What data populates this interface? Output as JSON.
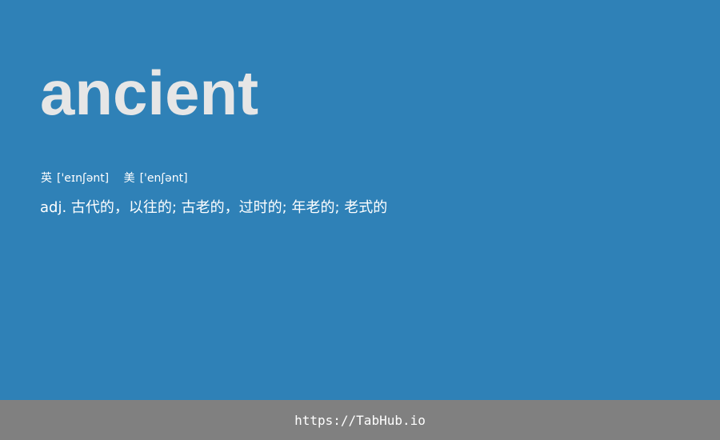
{
  "word": "ancient",
  "phonetics": {
    "uk_label": "英",
    "uk_ipa": "['eɪnʃənt]",
    "us_label": "美",
    "us_ipa": "['enʃənt]"
  },
  "definition": "adj. 古代的，以往的; 古老的，过时的; 年老的; 老式的",
  "footer": {
    "url": "https://TabHub.io"
  },
  "colors": {
    "background": "#2f81b7",
    "word_text": "#e6e6e6",
    "footer_bg": "#808080",
    "text": "#ffffff"
  }
}
